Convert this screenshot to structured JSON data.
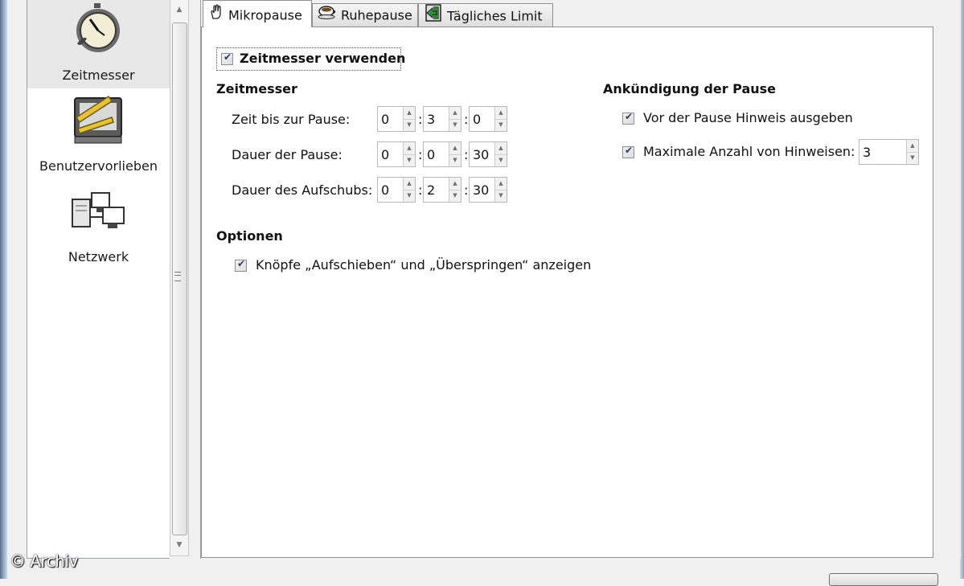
{
  "sidebar": {
    "items": [
      {
        "label": "Zeitmesser",
        "icon": "stopwatch-icon",
        "selected": true
      },
      {
        "label": "Benutzervorlieben",
        "icon": "monitor-ruler-icon",
        "selected": false
      },
      {
        "label": "Netzwerk",
        "icon": "network-computers-icon",
        "selected": false
      }
    ]
  },
  "tabs": [
    {
      "label": "Mikropause",
      "icon": "hand-icon",
      "active": true
    },
    {
      "label": "Ruhepause",
      "icon": "coffee-cup-icon",
      "active": false
    },
    {
      "label": "Tägliches Limit",
      "icon": "exit-door-icon",
      "active": false
    }
  ],
  "main": {
    "use_timer": {
      "label": "Zeitmesser verwenden",
      "checked": true
    },
    "timer_section": {
      "title": "Zeitmesser",
      "rows": [
        {
          "label": "Zeit bis zur Pause:",
          "h": "0",
          "m": "3",
          "s": "0"
        },
        {
          "label": "Dauer der Pause:",
          "h": "0",
          "m": "0",
          "s": "30"
        },
        {
          "label": "Dauer des Aufschubs:",
          "h": "0",
          "m": "2",
          "s": "30"
        }
      ],
      "separator": ":"
    },
    "announce_section": {
      "title": "Ankündigung der Pause",
      "notify": {
        "label": "Vor der Pause Hinweis ausgeben",
        "checked": true
      },
      "max_hints": {
        "label": "Maximale Anzahl von Hinweisen:",
        "checked": true,
        "value": "3"
      }
    },
    "options_section": {
      "title": "Optionen",
      "show_buttons": {
        "label": "Knöpfe „Aufschieben“ und „Überspringen“ anzeigen",
        "checked": true
      }
    }
  },
  "watermark": "© Archiv",
  "colors": {
    "accent": "#2b3a6b",
    "selection": "#e8e8e8",
    "border": "#8e8f8f"
  }
}
